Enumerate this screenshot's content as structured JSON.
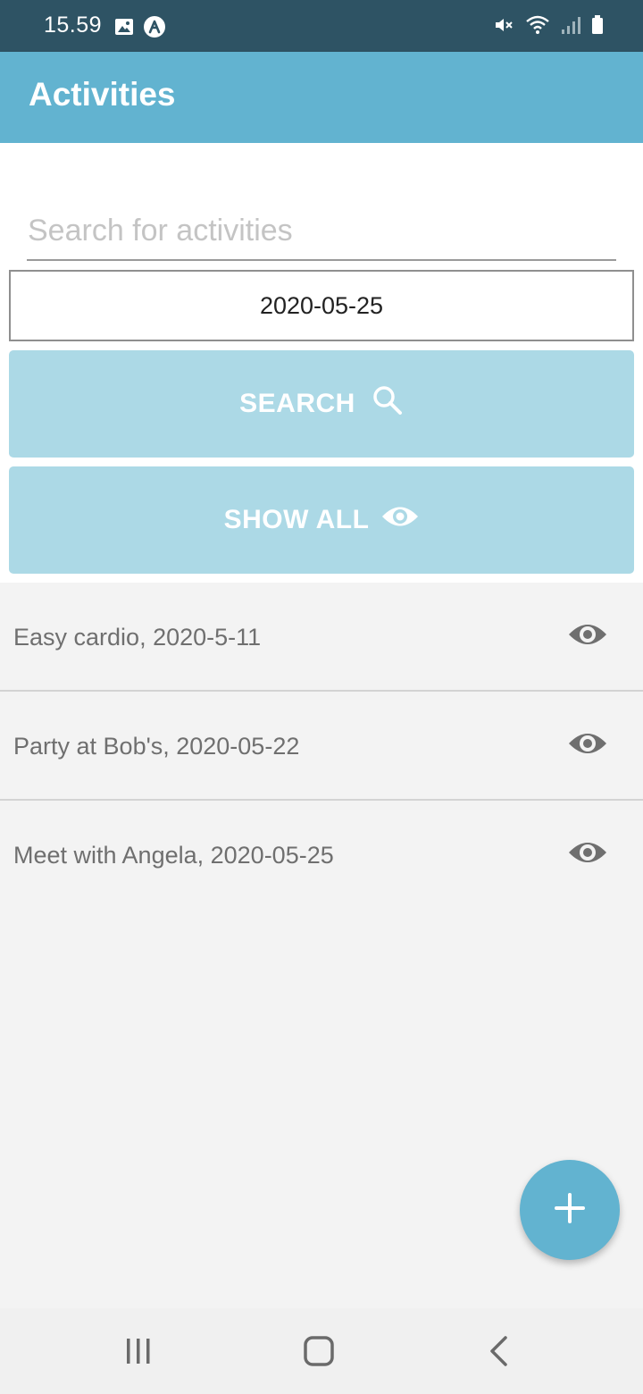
{
  "status_bar": {
    "time": "15.59",
    "icons": [
      "image-icon",
      "app-a-icon",
      "mute-icon",
      "wifi-icon",
      "signal-icon",
      "battery-icon"
    ]
  },
  "app_bar": {
    "title": "Activities"
  },
  "search": {
    "placeholder": "Search for activities",
    "value": ""
  },
  "date_field": {
    "value": "2020-05-25"
  },
  "buttons": {
    "search_label": "SEARCH",
    "search_icon": "search-icon",
    "show_all_label": "SHOW ALL",
    "show_all_icon": "eye-icon"
  },
  "activities": [
    {
      "label": "Easy cardio, 2020-5-11",
      "icon": "eye-icon"
    },
    {
      "label": "Party at Bob's, 2020-05-22",
      "icon": "eye-icon"
    },
    {
      "label": "Meet with Angela, 2020-05-25",
      "icon": "eye-icon"
    }
  ],
  "fab": {
    "icon": "plus-icon"
  },
  "nav_bar": {
    "icons": [
      "recents-icon",
      "home-icon",
      "back-icon"
    ]
  },
  "colors": {
    "status_bar": "#2e5364",
    "app_bar": "#62b3d0",
    "button_bg": "#acd9e6",
    "list_bg": "#f3f3f3",
    "list_text": "#6f6f6f",
    "fab": "#62b3d0"
  }
}
